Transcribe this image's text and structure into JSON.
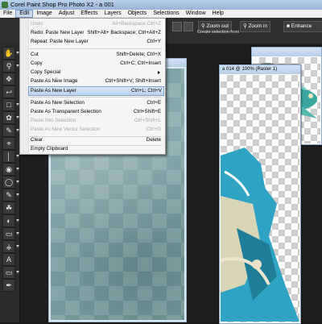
{
  "window": {
    "title": "Corel Paint Shop Pro Photo X2 - a 001"
  },
  "menubar": [
    "File",
    "Edit",
    "Image",
    "Adjust",
    "Effects",
    "Layers",
    "Objects",
    "Selections",
    "Window",
    "Help"
  ],
  "toolbar": {
    "zoom_out_label": "Zoom out",
    "zoom_in_label": "Zoom in",
    "enhance_label": "Enhance",
    "create_selection_label": "Create selection from"
  },
  "documents": {
    "doc_a_title": "a 014 @ 100% (Raster 1)",
    "doc_b_title": ""
  },
  "edit_menu": {
    "items": [
      {
        "label": "Undo",
        "shortcut": "Alt+Backspace Ctrl+Z",
        "enabled": false
      },
      {
        "label": "Redo: Paste New Layer",
        "shortcut": "Shift+Alt+ Backspace; Ctrl+Alt+Z",
        "enabled": true
      },
      {
        "label": "Repeat: Paste New Layer",
        "shortcut": "Ctrl+Y",
        "enabled": true
      },
      {
        "label": "Cut",
        "shortcut": "Shift+Delete; Ctrl+X",
        "enabled": true
      },
      {
        "label": "Copy",
        "shortcut": "Ctrl+C; Ctrl+Insert",
        "enabled": true
      },
      {
        "label": "Copy Special",
        "shortcut": "",
        "enabled": true,
        "submenu": true
      },
      {
        "label": "Paste As New Image",
        "shortcut": "Ctrl+Shift+V; Shift+Insert",
        "enabled": true
      },
      {
        "label": "Paste As New Layer",
        "shortcut": "Ctrl+L; Ctrl+V",
        "enabled": true,
        "highlighted": true
      },
      {
        "label": "Paste As New Selection",
        "shortcut": "Ctrl+E",
        "enabled": true
      },
      {
        "label": "Paste As Transparent Selection",
        "shortcut": "Ctrl+Shift+E",
        "enabled": true
      },
      {
        "label": "Paste Into Selection",
        "shortcut": "Ctrl+Shift+L",
        "enabled": false
      },
      {
        "label": "Paste As New Vector Selection",
        "shortcut": "Ctrl+G",
        "enabled": false
      },
      {
        "label": "Clear",
        "shortcut": "Delete",
        "enabled": true
      },
      {
        "label": "Empty Clipboard",
        "shortcut": "",
        "enabled": true
      }
    ]
  },
  "colors": {
    "highlight": "#bcd2ef",
    "menu_bg": "#f5f5f5",
    "paper_teal": "#7ea2a5",
    "dress_teal": "#2fa3c4"
  },
  "tools": [
    "pan",
    "zoom",
    "move",
    "pick",
    "selection",
    "freehand",
    "magic-wand",
    "dropper",
    "crop",
    "straighten",
    "makeover",
    "clone",
    "scratch-remover",
    "paint-brush",
    "airbrush",
    "eraser",
    "fill",
    "text",
    "shape",
    "pen"
  ]
}
